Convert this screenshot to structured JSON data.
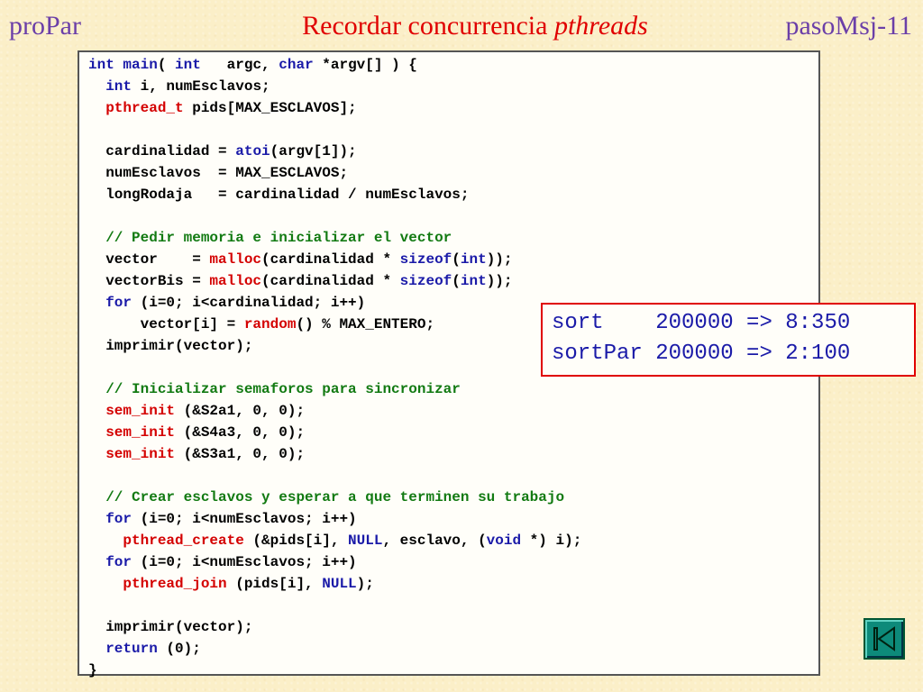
{
  "header": {
    "left": "proPar",
    "title_main": "Recordar concurrencia ",
    "title_italic": "pthreads",
    "right": "pasoMsj-11"
  },
  "code": {
    "l1": {
      "a": "int",
      "b": " ",
      "c": "main",
      "d": "( ",
      "e": "int",
      "f": "   argc, ",
      "g": "char",
      "h": " *argv[] ) {"
    },
    "l2": {
      "a": "  ",
      "b": "int",
      "c": " i, numEsclavos;"
    },
    "l3": {
      "a": "  ",
      "b": "pthread_t",
      "c": " pids[MAX_ESCLAVOS];"
    },
    "l5": {
      "a": "  cardinalidad = ",
      "b": "atoi",
      "c": "(argv[1]);"
    },
    "l6": "  numEsclavos  = MAX_ESCLAVOS;",
    "l7": "  longRodaja   = cardinalidad / numEsclavos;",
    "l9": "  // Pedir memoria e inicializar el vector",
    "l10": {
      "a": "  vector    = ",
      "b": "malloc",
      "c": "(cardinalidad * ",
      "d": "sizeof",
      "e": "(",
      "f": "int",
      "g": "));"
    },
    "l11": {
      "a": "  vectorBis = ",
      "b": "malloc",
      "c": "(cardinalidad * ",
      "d": "sizeof",
      "e": "(",
      "f": "int",
      "g": "));"
    },
    "l12": {
      "a": "  ",
      "b": "for",
      "c": " (i=0; i<cardinalidad; i++)"
    },
    "l13": {
      "a": "      vector[i] = ",
      "b": "random",
      "c": "() % MAX_ENTERO;"
    },
    "l14": "  imprimir(vector);",
    "l16": "  // Inicializar semaforos para sincronizar",
    "l17": {
      "a": "  ",
      "b": "sem_init",
      "c": " (&S2a1, 0, 0);"
    },
    "l18": {
      "a": "  ",
      "b": "sem_init",
      "c": " (&S4a3, 0, 0);"
    },
    "l19": {
      "a": "  ",
      "b": "sem_init",
      "c": " (&S3a1, 0, 0);"
    },
    "l21": "  // Crear esclavos y esperar a que terminen su trabajo",
    "l22": {
      "a": "  ",
      "b": "for",
      "c": " (i=0; i<numEsclavos; i++)"
    },
    "l23": {
      "a": "    ",
      "b": "pthread_create",
      "c": " (&pids[i], ",
      "d": "NULL",
      "e": ", esclavo, (",
      "f": "void",
      "g": " *) i);"
    },
    "l24": {
      "a": "  ",
      "b": "for",
      "c": " (i=0; i<numEsclavos; i++)"
    },
    "l25": {
      "a": "    ",
      "b": "pthread_join",
      "c": " (pids[i], ",
      "d": "NULL",
      "e": ");"
    },
    "l27": "  imprimir(vector);",
    "l28": {
      "a": "  ",
      "b": "return",
      "c": " (0);"
    },
    "l29": "}"
  },
  "results": {
    "line1": "sort    200000 => 8:350",
    "line2": "sortPar 200000 => 2:100"
  },
  "colors": {
    "keyword": "#1a1aa8",
    "function": "#d40000",
    "comment": "#127a12",
    "title": "#e00000",
    "header_side": "#6b3fa8"
  },
  "nav": {
    "icon": "skip-back-icon"
  }
}
